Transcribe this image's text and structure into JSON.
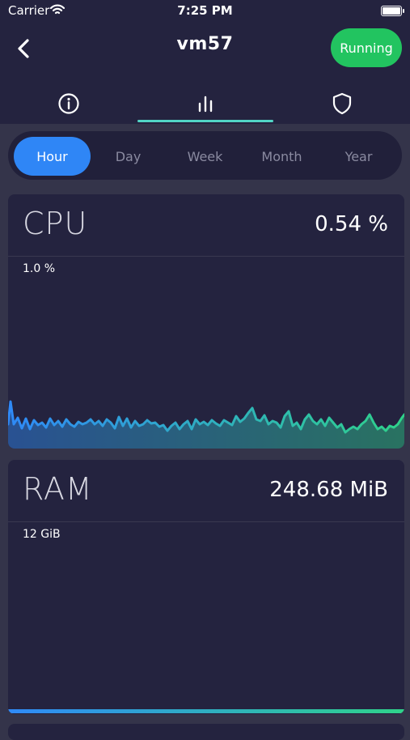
{
  "status_bar": {
    "carrier": "Carrier",
    "time": "7:25 PM"
  },
  "header": {
    "title": "vm57",
    "status_label": "Running"
  },
  "tabs": [
    {
      "name": "info",
      "icon": "info-icon"
    },
    {
      "name": "stats",
      "icon": "bar-chart-icon",
      "active": true
    },
    {
      "name": "security",
      "icon": "shield-icon"
    }
  ],
  "ranges": [
    "Hour",
    "Day",
    "Week",
    "Month",
    "Year"
  ],
  "active_range": "Hour",
  "cpu": {
    "title": "CPU",
    "value": "0.54 %",
    "max_label": "1.0 %"
  },
  "ram": {
    "title": "RAM",
    "value": "248.68 MiB",
    "max_label": "12 GiB"
  },
  "colors": {
    "accent": "#2f86f6",
    "running": "#22c460",
    "gradient_start": "#2f8af8",
    "gradient_end": "#2fd38a",
    "card": "#24233f",
    "background": "#34344a"
  }
}
